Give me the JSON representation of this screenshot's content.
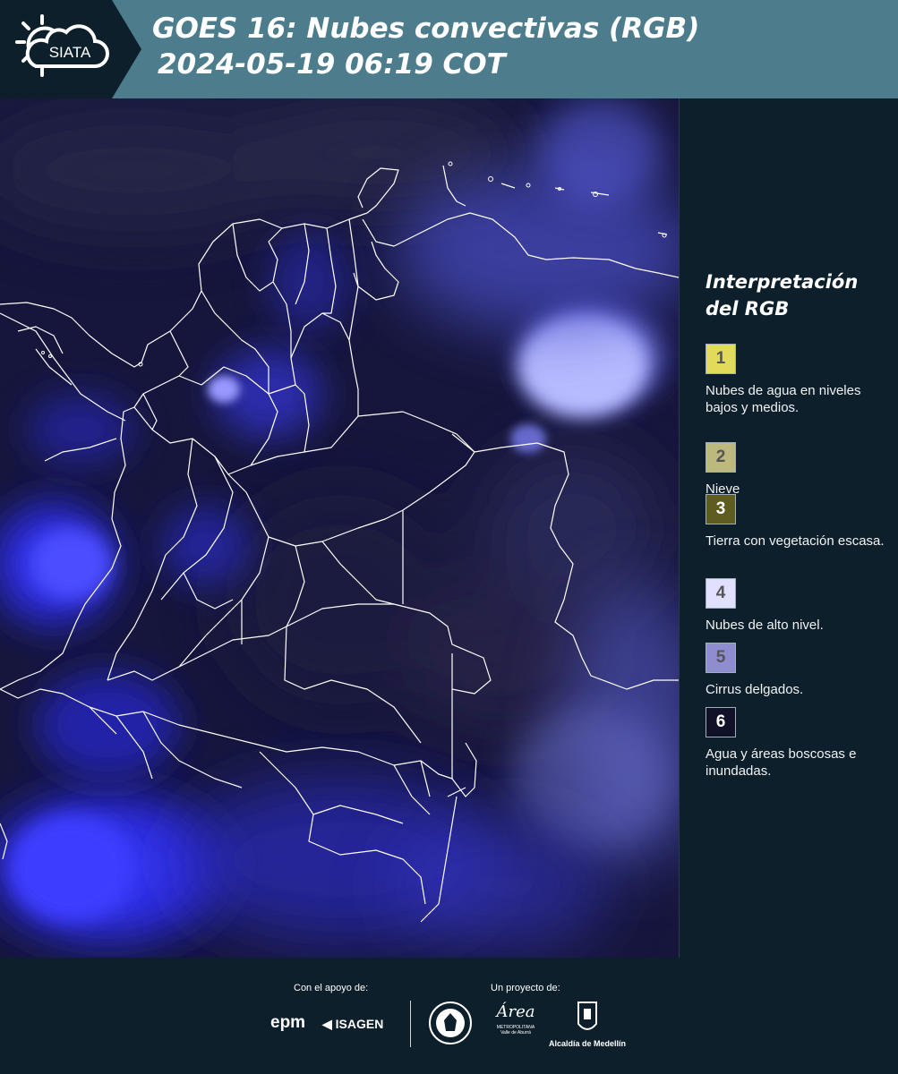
{
  "header": {
    "logo_text": "SIATA",
    "title_line1": "GOES 16: Nubes convectivas (RGB)",
    "title_line2": "2024-05-19 06:19 COT"
  },
  "legend": {
    "title_line1": "Interpretación",
    "title_line2": "del RGB",
    "items": [
      {
        "num": "1",
        "label": "Nubes de agua en niveles bajos y medios.",
        "color": "#e0dc5a"
      },
      {
        "num": "2",
        "label": "Nieve",
        "color": "#bcb87e"
      },
      {
        "num": "3",
        "label": "Tierra con vegetación escasa.",
        "color": "#5f5c22"
      },
      {
        "num": "4",
        "label": "Nubes de alto nivel.",
        "color": "#e1e1ff"
      },
      {
        "num": "5",
        "label": "Cirrus delgados.",
        "color": "#8d8dd0"
      },
      {
        "num": "6",
        "label": "Agua y áreas boscosas e inundadas.",
        "color": "#101028"
      }
    ]
  },
  "footer": {
    "support_label": "Con el apoyo de:",
    "project_label": "Un proyecto de:",
    "sponsor1": "epm",
    "sponsor2": "ISAGEN",
    "partner_area": "Área",
    "partner_area_sub1": "METROPOLITANA",
    "partner_area_sub2": "Valle de Aburrá",
    "partner_alcaldia": "Alcaldía de Medellín"
  }
}
